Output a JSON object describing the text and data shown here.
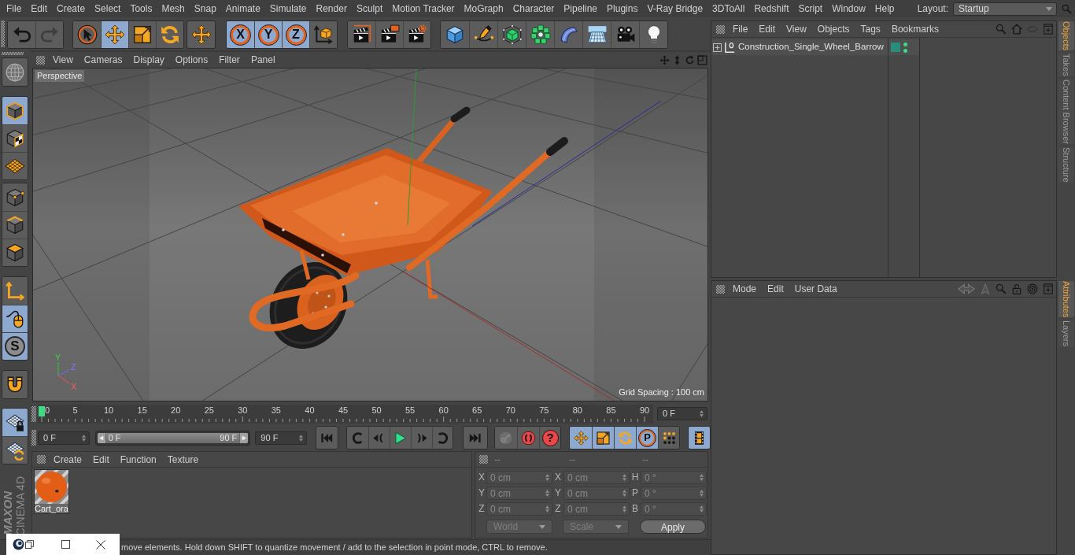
{
  "menu_bar": {
    "items": [
      "File",
      "Edit",
      "Create",
      "Select",
      "Tools",
      "Mesh",
      "Snap",
      "Animate",
      "Simulate",
      "Render",
      "Sculpt",
      "Motion Tracker",
      "MoGraph",
      "Character",
      "Pipeline",
      "Plugins",
      "V-Ray Bridge",
      "3DToAll",
      "Redshift",
      "Script",
      "Window",
      "Help"
    ],
    "layout_label": "Layout:",
    "layout_value": "Startup"
  },
  "toolbar": {
    "groups": [
      [
        {
          "kind": "undo",
          "selected": false,
          "disabled": false
        },
        {
          "kind": "redo",
          "selected": false,
          "disabled": true
        }
      ],
      [
        {
          "kind": "select",
          "selected": false,
          "disabled": false
        },
        {
          "kind": "move",
          "selected": true,
          "disabled": false
        },
        {
          "kind": "scale",
          "selected": false,
          "disabled": false
        },
        {
          "kind": "rotate",
          "selected": false,
          "disabled": false
        }
      ],
      [
        {
          "kind": "move",
          "selected": false,
          "disabled": false
        }
      ],
      [
        {
          "kind": "axis_lock",
          "label": "X",
          "selected": true,
          "disabled": false
        },
        {
          "kind": "axis_lock",
          "label": "Y",
          "selected": true,
          "disabled": false
        },
        {
          "kind": "axis_lock",
          "label": "Z",
          "selected": true,
          "disabled": false
        },
        {
          "kind": "coordinates",
          "selected": false,
          "disabled": false
        }
      ],
      [
        {
          "kind": "render_view",
          "selected": false,
          "disabled": false
        },
        {
          "kind": "render_picture",
          "selected": false,
          "disabled": false
        },
        {
          "kind": "render_settings",
          "selected": false,
          "disabled": false
        }
      ],
      [
        {
          "kind": "cube",
          "selected": false,
          "disabled": false
        },
        {
          "kind": "pen",
          "selected": false,
          "disabled": false
        },
        {
          "kind": "subdivision",
          "selected": false,
          "disabled": false
        },
        {
          "kind": "cloner",
          "selected": false,
          "disabled": false
        },
        {
          "kind": "deformer",
          "selected": false,
          "disabled": false
        },
        {
          "kind": "floor",
          "selected": false,
          "disabled": false
        },
        {
          "kind": "camera",
          "selected": false,
          "disabled": false
        },
        {
          "kind": "light",
          "selected": false,
          "disabled": false
        }
      ]
    ]
  },
  "mode_palette": {
    "groups": [
      [
        {
          "kind": "globe",
          "selected": false
        }
      ],
      [
        {
          "kind": "model",
          "selected": true
        },
        {
          "kind": "texture",
          "selected": false
        },
        {
          "kind": "workplane",
          "selected": false
        }
      ],
      [
        {
          "kind": "points",
          "selected": false
        },
        {
          "kind": "edges",
          "selected": false
        },
        {
          "kind": "polygons",
          "selected": false
        }
      ],
      [
        {
          "kind": "axis",
          "selected": false
        },
        {
          "kind": "tweak",
          "selected": true
        },
        {
          "kind": "solo",
          "label": "S",
          "selected": true
        }
      ],
      [
        {
          "kind": "magnet",
          "selected": false
        }
      ],
      [
        {
          "kind": "grid_lock",
          "selected": true
        },
        {
          "kind": "grid_refresh",
          "selected": false
        }
      ]
    ]
  },
  "logo": {
    "brand": "MAXON",
    "product": "CINEMA 4D"
  },
  "viewport": {
    "menu": [
      "View",
      "Cameras",
      "Display",
      "Options",
      "Filter",
      "Panel"
    ],
    "camera": "Perspective",
    "grid_spacing": "Grid Spacing : 100 cm",
    "axis_labels": [
      "Y",
      "Z",
      "X"
    ]
  },
  "timeline": {
    "ticks": [
      "0",
      "5",
      "10",
      "15",
      "20",
      "25",
      "30",
      "35",
      "40",
      "45",
      "50",
      "55",
      "60",
      "65",
      "70",
      "75",
      "80",
      "85",
      "90"
    ],
    "playhead": {
      "level": 0
    },
    "current_frame": "0 F"
  },
  "playback": {
    "start_frame": "0 F",
    "range_slider": {
      "start": "0 F",
      "end": "90 F",
      "level": 1
    },
    "end_frame": "90 F",
    "groups": [
      [
        {
          "kind": "go_start",
          "selected": false,
          "disabled": false
        }
      ],
      [
        {
          "kind": "prev_key",
          "selected": false,
          "disabled": false
        },
        {
          "kind": "prev_frame",
          "selected": false,
          "disabled": false
        },
        {
          "kind": "play",
          "selected": false,
          "disabled": false
        },
        {
          "kind": "next_frame",
          "selected": false,
          "disabled": false
        },
        {
          "kind": "next_key",
          "selected": false,
          "disabled": false
        }
      ],
      [
        {
          "kind": "go_end",
          "selected": false,
          "disabled": false
        }
      ],
      [
        {
          "kind": "keyframe",
          "selected": false,
          "disabled": true
        },
        {
          "kind": "record",
          "selected": false,
          "disabled": false
        },
        {
          "kind": "autokey",
          "label": "?",
          "selected": false,
          "disabled": false
        }
      ],
      [
        {
          "kind": "move",
          "selected": true,
          "disabled": false
        },
        {
          "kind": "scale",
          "selected": true,
          "disabled": false
        },
        {
          "kind": "rotate",
          "selected": true,
          "disabled": false
        },
        {
          "kind": "parameter",
          "label": "P",
          "selected": true,
          "disabled": false
        },
        {
          "kind": "point_level",
          "selected": false,
          "disabled": false
        }
      ],
      [
        {
          "kind": "timeline_window",
          "selected": true,
          "disabled": false
        }
      ]
    ]
  },
  "materials": {
    "menu": [
      "Create",
      "Edit",
      "Function",
      "Texture"
    ],
    "items": [
      {
        "name": "Cart_ora"
      }
    ]
  },
  "coordinates": {
    "disabled": true,
    "headers": [
      "--",
      "--",
      "--"
    ],
    "columns": [
      [
        {
          "axis": "X",
          "value": "0 cm"
        },
        {
          "axis": "Y",
          "value": "0 cm"
        },
        {
          "axis": "Z",
          "value": "0 cm"
        }
      ],
      [
        {
          "axis": "X",
          "value": "0 cm"
        },
        {
          "axis": "Y",
          "value": "0 cm"
        },
        {
          "axis": "Z",
          "value": "0 cm"
        }
      ],
      [
        {
          "axis": "H",
          "value": "0 °"
        },
        {
          "axis": "P",
          "value": "0 °"
        },
        {
          "axis": "B",
          "value": "0 °"
        }
      ]
    ],
    "dropdowns": [
      "World",
      "Scale"
    ],
    "apply": "Apply"
  },
  "status_bar": {
    "text": "move elements. Hold down SHIFT to quantize movement / add to the selection in point mode, CTRL to remove."
  },
  "object_manager": {
    "menu": [
      "File",
      "Edit",
      "View",
      "Objects",
      "Tags",
      "Bookmarks"
    ],
    "objects": [
      {
        "name": "Construction_Single_Wheel_Barrow",
        "expanded": false,
        "color": "#2a8c7c",
        "editor_visible": true,
        "render_visible": true
      }
    ],
    "tabs": [
      {
        "label": "Objects",
        "selected": true
      },
      {
        "label": "Takes",
        "selected": false
      },
      {
        "label": "Content Browser",
        "selected": false
      },
      {
        "label": "Structure",
        "selected": false
      }
    ]
  },
  "attribute_manager": {
    "menu": [
      "Mode",
      "Edit",
      "User Data"
    ],
    "icons": [
      {
        "kind": "history",
        "disabled": true
      },
      {
        "kind": "up",
        "disabled": true
      },
      {
        "kind": "search",
        "disabled": false
      },
      {
        "kind": "lock",
        "disabled": false
      },
      {
        "kind": "target",
        "disabled": false
      },
      {
        "kind": "new_panel",
        "disabled": false
      }
    ],
    "tabs": [
      {
        "label": "Attributes",
        "selected": true
      },
      {
        "label": "Layers",
        "selected": false
      }
    ]
  }
}
